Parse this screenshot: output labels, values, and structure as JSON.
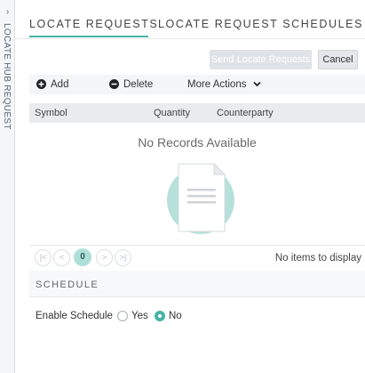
{
  "sidebar": {
    "label": "LOCATE HUB REQUEST",
    "collapse_glyph": "›"
  },
  "tabs": [
    {
      "label": "LOCATE REQUESTS"
    },
    {
      "label": "LOCATE REQUEST SCHEDULES"
    }
  ],
  "actions": {
    "send_label": "Send Locate Requests",
    "cancel_label": "Cancel"
  },
  "toolbar": {
    "add_label": "Add",
    "delete_label": "Delete",
    "more_label": "More Actions"
  },
  "table": {
    "columns": [
      "Symbol",
      "Quantity",
      "Counterparty"
    ],
    "empty_message": "No Records Available"
  },
  "pager": {
    "current_page": "0",
    "info": "No items to display"
  },
  "schedule": {
    "title": "SCHEDULE",
    "enable_label": "Enable Schedule",
    "yes_label": "Yes",
    "no_label": "No"
  },
  "colors": {
    "accent": "#48b3a6",
    "accent_light": "#aee0d8"
  }
}
